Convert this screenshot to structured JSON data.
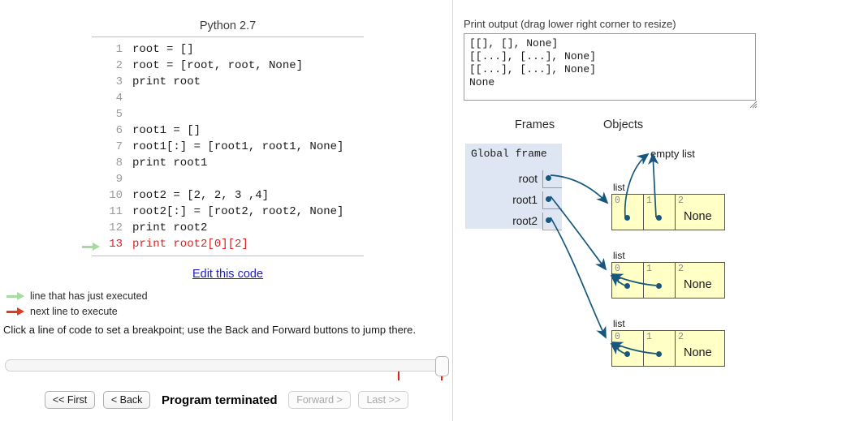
{
  "left": {
    "code_title": "Python 2.7",
    "code_lines": [
      {
        "num": "1",
        "text": "root = []",
        "current": false
      },
      {
        "num": "2",
        "text": "root = [root, root, None]",
        "current": false
      },
      {
        "num": "3",
        "text": "print root",
        "current": false
      },
      {
        "num": "4",
        "text": "",
        "current": false
      },
      {
        "num": "5",
        "text": "",
        "current": false
      },
      {
        "num": "6",
        "text": "root1 = []",
        "current": false
      },
      {
        "num": "7",
        "text": "root1[:] = [root1, root1, None]",
        "current": false
      },
      {
        "num": "8",
        "text": "print root1",
        "current": false
      },
      {
        "num": "9",
        "text": "",
        "current": false
      },
      {
        "num": "10",
        "text": "root2 = [2, 2, 3 ,4]",
        "current": false
      },
      {
        "num": "11",
        "text": "root2[:] = [root2, root2, None]",
        "current": false
      },
      {
        "num": "12",
        "text": "print root2",
        "current": false
      },
      {
        "num": "13",
        "text": "print root2[0][2]",
        "current": true
      }
    ],
    "edit_link": "Edit this code",
    "legend": [
      {
        "label": "line that has just executed",
        "color": "#a6dba0"
      },
      {
        "label": "next line to execute",
        "color": "#e03b20"
      }
    ],
    "breakpoint_note": "Click a line of code to set a breakpoint; use the Back and Forward buttons to jump there.",
    "controls": {
      "first_label": "<< First",
      "back_label": "< Back",
      "status": "Program terminated",
      "forward_label": "Forward >",
      "last_label": "Last >>"
    }
  },
  "right": {
    "output_label": "Print output (drag lower right corner to resize)",
    "output_text": "[[], [], None]\n[[...], [...], None]\n[[...], [...], None]\nNone",
    "frames_header": "Frames",
    "objects_header": "Objects",
    "global_frame": {
      "title": "Global frame",
      "variables": [
        {
          "name": "root"
        },
        {
          "name": "root1"
        },
        {
          "name": "root2"
        }
      ]
    },
    "empty_list_label": "empty list",
    "objects": [
      {
        "type_label": "list",
        "cells": [
          {
            "index": "0",
            "kind": "pointer",
            "value": ""
          },
          {
            "index": "1",
            "kind": "pointer",
            "value": ""
          },
          {
            "index": "2",
            "kind": "value",
            "value": "None"
          }
        ]
      },
      {
        "type_label": "list",
        "cells": [
          {
            "index": "0",
            "kind": "pointer",
            "value": ""
          },
          {
            "index": "1",
            "kind": "pointer",
            "value": ""
          },
          {
            "index": "2",
            "kind": "value",
            "value": "None"
          }
        ]
      },
      {
        "type_label": "list",
        "cells": [
          {
            "index": "0",
            "kind": "pointer",
            "value": ""
          },
          {
            "index": "1",
            "kind": "pointer",
            "value": ""
          },
          {
            "index": "2",
            "kind": "value",
            "value": "None"
          }
        ]
      }
    ]
  },
  "colors": {
    "arrow": "#17577d",
    "frame_bg": "#dde6f2",
    "list_bg": "#ffffc6",
    "current_line": "#e02020",
    "just_executed": "#a6dba0",
    "link": "#2020c0"
  }
}
